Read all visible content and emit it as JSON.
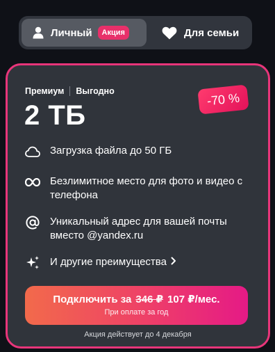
{
  "switcher": {
    "personal_label": "Личный",
    "promo_badge": "Акция",
    "family_label": "Для семьи"
  },
  "plan": {
    "tag_primary": "Премиум",
    "tag_secondary": "Выгодно",
    "size": "2 ТБ",
    "discount": "-70 %"
  },
  "features": [
    {
      "icon": "cloud-icon",
      "text": "Загрузка файла до 50 ГБ"
    },
    {
      "icon": "infinity-icon",
      "text": "Безлимитное место для фото и видео с телефона"
    },
    {
      "icon": "at-sign-icon",
      "text": "Уникальный адрес для вашей почты вместо @yandex.ru"
    },
    {
      "icon": "sparkles-icon",
      "text": "И другие преимущества"
    }
  ],
  "cta": {
    "prefix": "Подключить за",
    "old_price": "346 ₽",
    "new_price": "107 ₽/мес.",
    "subtitle": "При оплате за год"
  },
  "footnote": "Акция действует до 4 декабря",
  "colors": {
    "accent": "#e8357a",
    "card_bg": "#30343b",
    "page_bg": "#0f1117"
  }
}
